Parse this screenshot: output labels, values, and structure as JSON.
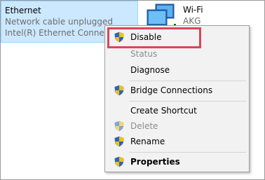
{
  "ethernet": {
    "name": "Ethernet",
    "status": "Network cable unplugged",
    "device": "Intel(R) Ethernet Connectio"
  },
  "wifi": {
    "name": "Wi-Fi",
    "ssid": "AKG",
    "icon": "wifi-adapter-icon"
  },
  "context_menu": {
    "items": [
      {
        "label": "Disable",
        "icon": "shield-icon",
        "enabled": true
      },
      {
        "label": "Status",
        "enabled": false
      },
      {
        "label": "Diagnose",
        "enabled": true
      },
      {
        "label": "Bridge Connections",
        "icon": "shield-icon",
        "enabled": true
      },
      {
        "label": "Create Shortcut",
        "enabled": true
      },
      {
        "label": "Delete",
        "icon": "shield-icon",
        "enabled": false
      },
      {
        "label": "Rename",
        "icon": "shield-icon",
        "enabled": true
      },
      {
        "label": "Properties",
        "icon": "shield-icon",
        "enabled": true,
        "bold": true
      }
    ]
  },
  "colors": {
    "selection_bg": "#cce8ff",
    "highlight_border": "#d9465a",
    "menu_bg": "#f2f2f2"
  }
}
